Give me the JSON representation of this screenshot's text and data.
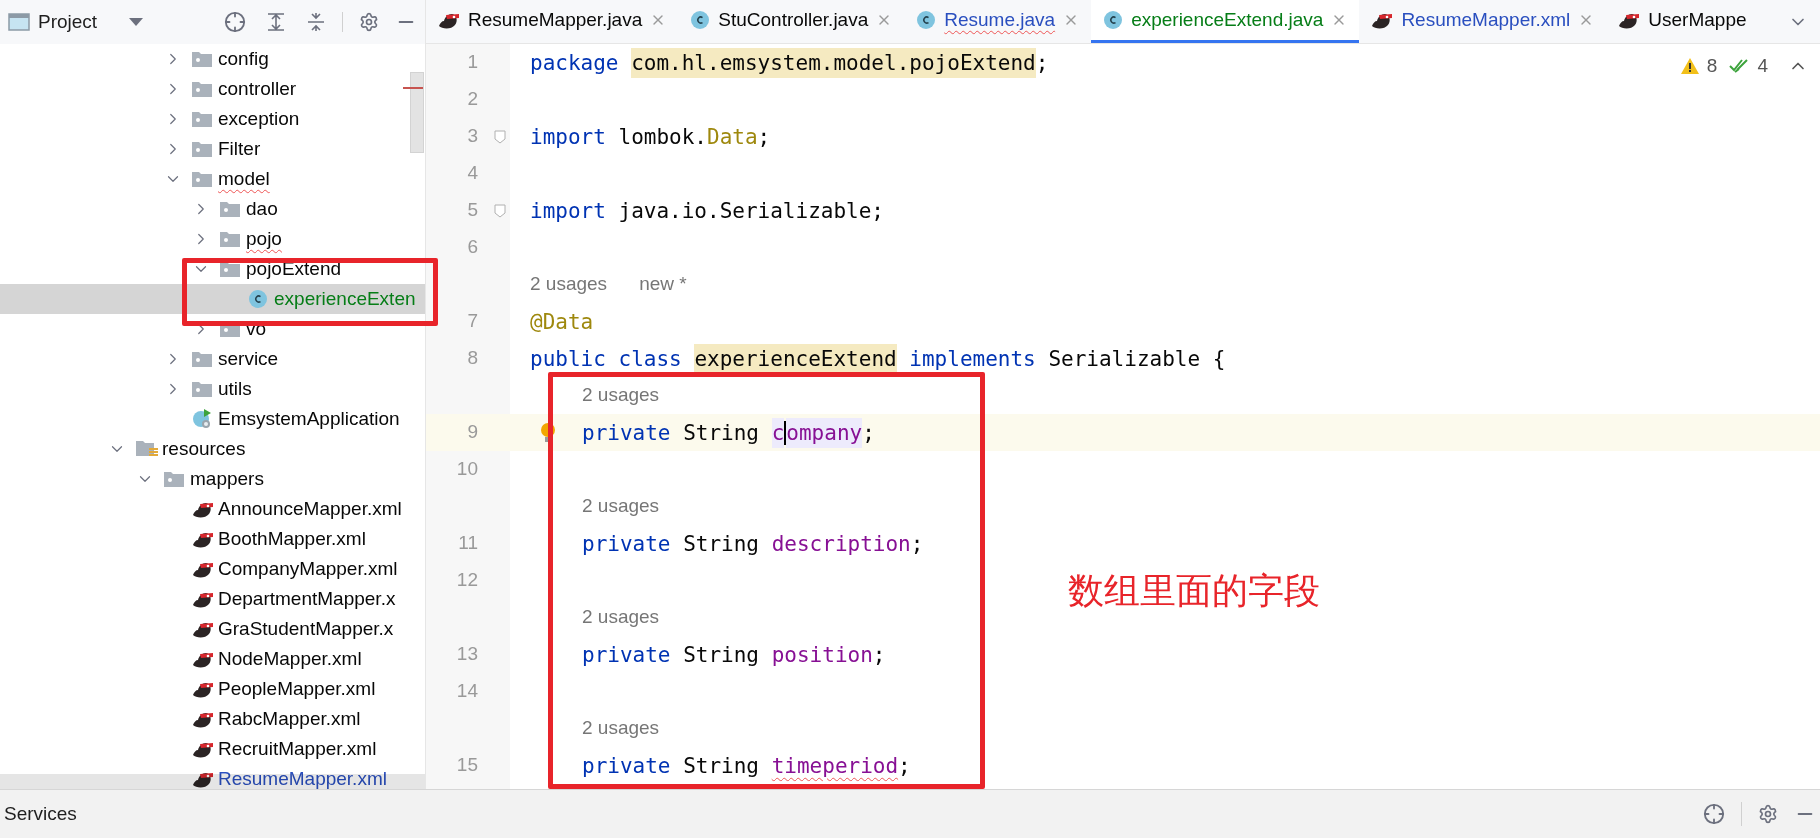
{
  "project_panel": {
    "title": "Project"
  },
  "tree": [
    {
      "kind": "hidden",
      "children": [
        {
          "kind": "hidden",
          "children": [
            {
              "kind": "folder",
              "label": "config",
              "expanded": false,
              "selected": false
            },
            {
              "kind": "folder",
              "label": "controller",
              "expanded": false,
              "selected": false
            },
            {
              "kind": "folder",
              "label": "exception",
              "expanded": false,
              "selected": false
            },
            {
              "kind": "folder",
              "label": "Filter",
              "expanded": false,
              "selected": false
            },
            {
              "kind": "folder",
              "label": "model",
              "expanded": true,
              "misspelled": true,
              "selected": false,
              "children": [
                {
                  "kind": "folder",
                  "label": "dao",
                  "expanded": false,
                  "selected": false
                },
                {
                  "kind": "folder",
                  "label": "pojo",
                  "expanded": false,
                  "misspelled": true,
                  "selected": false
                },
                {
                  "kind": "folder",
                  "label": "pojoExtend",
                  "expanded": true,
                  "selected": false,
                  "children": [
                    {
                      "kind": "class",
                      "label": "experienceExten",
                      "selected": true,
                      "color": "#067d17"
                    }
                  ]
                },
                {
                  "kind": "folder",
                  "label": "vo",
                  "expanded": false,
                  "selected": false
                }
              ]
            },
            {
              "kind": "folder",
              "label": "service",
              "expanded": false,
              "selected": false
            },
            {
              "kind": "folder",
              "label": "utils",
              "expanded": false,
              "selected": false
            },
            {
              "kind": "app",
              "label": "EmsystemApplication",
              "selected": false
            }
          ]
        }
      ]
    },
    {
      "kind": "resources",
      "label": "resources",
      "expanded": true,
      "selected": false,
      "children": [
        {
          "kind": "folder",
          "label": "mappers",
          "expanded": true,
          "selected": false,
          "children": [
            {
              "kind": "xml",
              "label": "AnnounceMapper.xml",
              "selected": false
            },
            {
              "kind": "xml",
              "label": "BoothMapper.xml",
              "selected": false
            },
            {
              "kind": "xml",
              "label": "CompanyMapper.xml",
              "selected": false
            },
            {
              "kind": "xml",
              "label": "DepartmentMapper.x",
              "selected": false
            },
            {
              "kind": "xml",
              "label": "GraStudentMapper.x",
              "selected": false
            },
            {
              "kind": "xml",
              "label": "NodeMapper.xml",
              "selected": false
            },
            {
              "kind": "xml",
              "label": "PeopleMapper.xml",
              "selected": false
            },
            {
              "kind": "xml",
              "label": "RabcMapper.xml",
              "selected": false
            },
            {
              "kind": "xml",
              "label": "RecruitMapper.xml",
              "selected": false
            },
            {
              "kind": "xml",
              "label": "ResumeMapper.xml",
              "selected": false,
              "color": "#2a4fbf"
            }
          ]
        }
      ]
    }
  ],
  "tabs": [
    {
      "label": "ResumeMapper.java",
      "kind": "mybatis",
      "color": "#080808",
      "selected": false
    },
    {
      "label": "StuController.java",
      "kind": "class",
      "color": "#080808",
      "selected": false
    },
    {
      "label": "Resume.java",
      "kind": "class",
      "color": "#2a4fbf",
      "misspelled": true,
      "selected": false
    },
    {
      "label": "experienceExtend.java",
      "kind": "class",
      "color": "#067d17",
      "selected": true
    },
    {
      "label": "ResumeMapper.xml",
      "kind": "mybatis",
      "color": "#2a4fbf",
      "selected": false
    },
    {
      "label": "UserMappe",
      "kind": "mybatis",
      "color": "#080808",
      "selected": false
    }
  ],
  "inspections": {
    "warnings": "8",
    "weak_warnings": "4"
  },
  "lines": [
    {
      "kind": "code",
      "number": "1",
      "tokens": [
        {
          "kind": "keyword",
          "text": "package "
        },
        {
          "kind": "match",
          "text": "com.hl.emsystem.model.pojoExtend"
        },
        {
          "kind": "plain",
          "text": ";"
        }
      ]
    },
    {
      "kind": "code",
      "number": "2"
    },
    {
      "kind": "code",
      "number": "3",
      "fold": true,
      "tokens": [
        {
          "kind": "keyword",
          "text": "import"
        },
        {
          "kind": "plain",
          "text": " lombok."
        },
        {
          "kind": "annotation",
          "text": "Data"
        },
        {
          "kind": "plain",
          "text": ";"
        }
      ]
    },
    {
      "kind": "code",
      "number": "4"
    },
    {
      "kind": "code",
      "number": "5",
      "fold": true,
      "tokens": [
        {
          "kind": "keyword",
          "text": "import"
        },
        {
          "kind": "plain",
          "text": " java.io.Serializable;"
        }
      ]
    },
    {
      "kind": "code",
      "number": "6"
    },
    {
      "kind": "hint",
      "texts": [
        "2 usages",
        "new *"
      ]
    },
    {
      "kind": "code",
      "number": "7",
      "tokens": [
        {
          "kind": "annotation",
          "text": "@Data"
        }
      ]
    },
    {
      "kind": "code",
      "number": "8",
      "tokens": [
        {
          "kind": "keyword",
          "text": "public class "
        },
        {
          "kind": "match",
          "text": "experienceExtend"
        },
        {
          "kind": "keyword",
          "text": " implements"
        },
        {
          "kind": "plain",
          "text": " Serializable {"
        }
      ]
    },
    {
      "kind": "member_hint",
      "texts": [
        "2 usages"
      ]
    },
    {
      "kind": "member",
      "number": "9",
      "current": true,
      "bulb": true,
      "tokens": [
        {
          "kind": "keyword",
          "text": "private"
        },
        {
          "kind": "plain",
          "text": " String "
        },
        {
          "kind": "current",
          "text": "c"
        },
        {
          "kind": "caret"
        },
        {
          "kind": "current",
          "text": "ompany"
        },
        {
          "kind": "plain",
          "text": ";"
        }
      ]
    },
    {
      "kind": "code",
      "number": "10"
    },
    {
      "kind": "member_hint",
      "texts": [
        "2 usages"
      ]
    },
    {
      "kind": "member",
      "number": "11",
      "tokens": [
        {
          "kind": "keyword",
          "text": "private"
        },
        {
          "kind": "plain",
          "text": " String "
        },
        {
          "kind": "field",
          "text": "description"
        },
        {
          "kind": "plain",
          "text": ";"
        }
      ]
    },
    {
      "kind": "code",
      "number": "12"
    },
    {
      "kind": "member_hint",
      "texts": [
        "2 usages"
      ]
    },
    {
      "kind": "member",
      "number": "13",
      "tokens": [
        {
          "kind": "keyword",
          "text": "private"
        },
        {
          "kind": "plain",
          "text": " String "
        },
        {
          "kind": "field",
          "text": "position"
        },
        {
          "kind": "plain",
          "text": ";"
        }
      ]
    },
    {
      "kind": "code",
      "number": "14"
    },
    {
      "kind": "member_hint",
      "texts": [
        "2 usages"
      ]
    },
    {
      "kind": "member",
      "number": "15",
      "tokens": [
        {
          "kind": "keyword",
          "text": "private"
        },
        {
          "kind": "plain",
          "text": " String "
        },
        {
          "kind": "typo",
          "text": "timeperiod"
        },
        {
          "kind": "plain",
          "text": ";"
        }
      ]
    }
  ],
  "annotation": {
    "text": "数组里面的字段"
  },
  "bottom_bar": {
    "title": "Services"
  }
}
